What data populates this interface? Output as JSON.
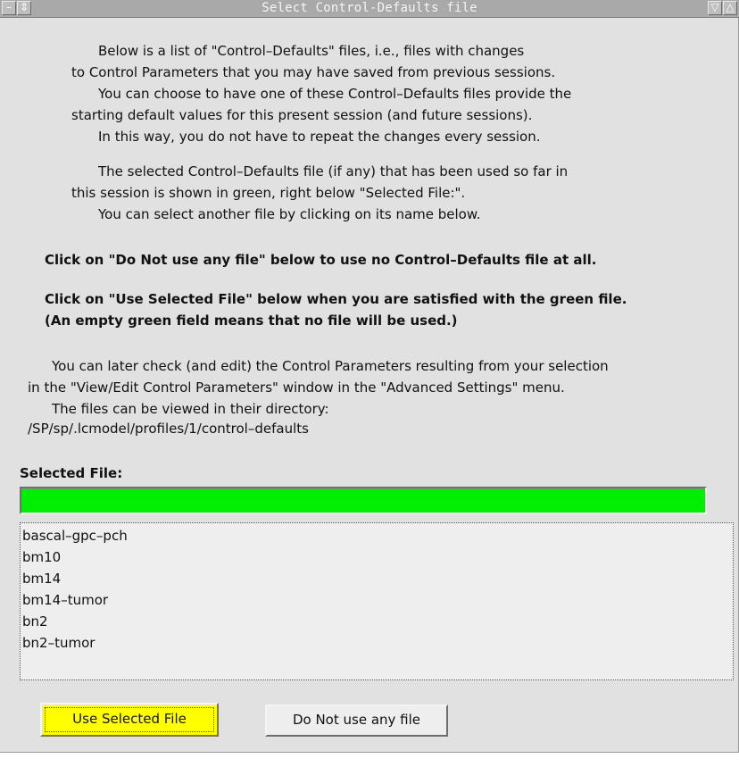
{
  "window": {
    "title": "Select Control-Defaults file"
  },
  "icons": {
    "minimize": "minimize-icon",
    "menu": "window-menu-icon",
    "shade": "shade-down-icon",
    "maximize": "maximize-icon"
  },
  "intro_lines": [
    "Below is a list of \"Control–Defaults\" files, i.e., files with changes",
    "to Control Parameters that you may have saved from previous sessions.",
    "You can choose to have one of these Control–Defaults files provide the",
    "starting default values for this present session (and future sessions).",
    "In this way, you do not have to repeat the changes every session."
  ],
  "selection_lines": [
    "The selected Control–Defaults file (if any) that has been used so far in",
    "this session is shown in green, right below \"Selected File:\".",
    "You can select another file by clicking on its name below."
  ],
  "bold_notes": {
    "do_not_use": "Click on \"Do Not use any file\" below to use no Control–Defaults file at all.",
    "use_selected": "Click on \"Use Selected File\" below when you are satisfied with the green file.",
    "empty_note": "(An empty green field means that no file will be used.)"
  },
  "later_lines": [
    "You can later check (and edit) the Control Parameters resulting from your selection",
    "in the \"View/Edit Control Parameters\" window in the \"Advanced Settings\" menu.",
    "The files can be viewed in their directory:",
    "/SP/sp/.lcmodel/profiles/1/control–defaults"
  ],
  "selected_file": {
    "label": "Selected File:",
    "value": ""
  },
  "files": [
    "bascal–gpc–pch",
    "bm10",
    "bm14",
    "bm14–tumor",
    "bn2",
    "bn2–tumor"
  ],
  "buttons": {
    "use_selected": "Use Selected File",
    "do_not_use": "Do Not use any file"
  },
  "colors": {
    "selected_field": "#00ee00",
    "use_button": "#ffff00",
    "window_bg": "#e1e1e1",
    "titlebar_bg": "#a9a9a9"
  }
}
